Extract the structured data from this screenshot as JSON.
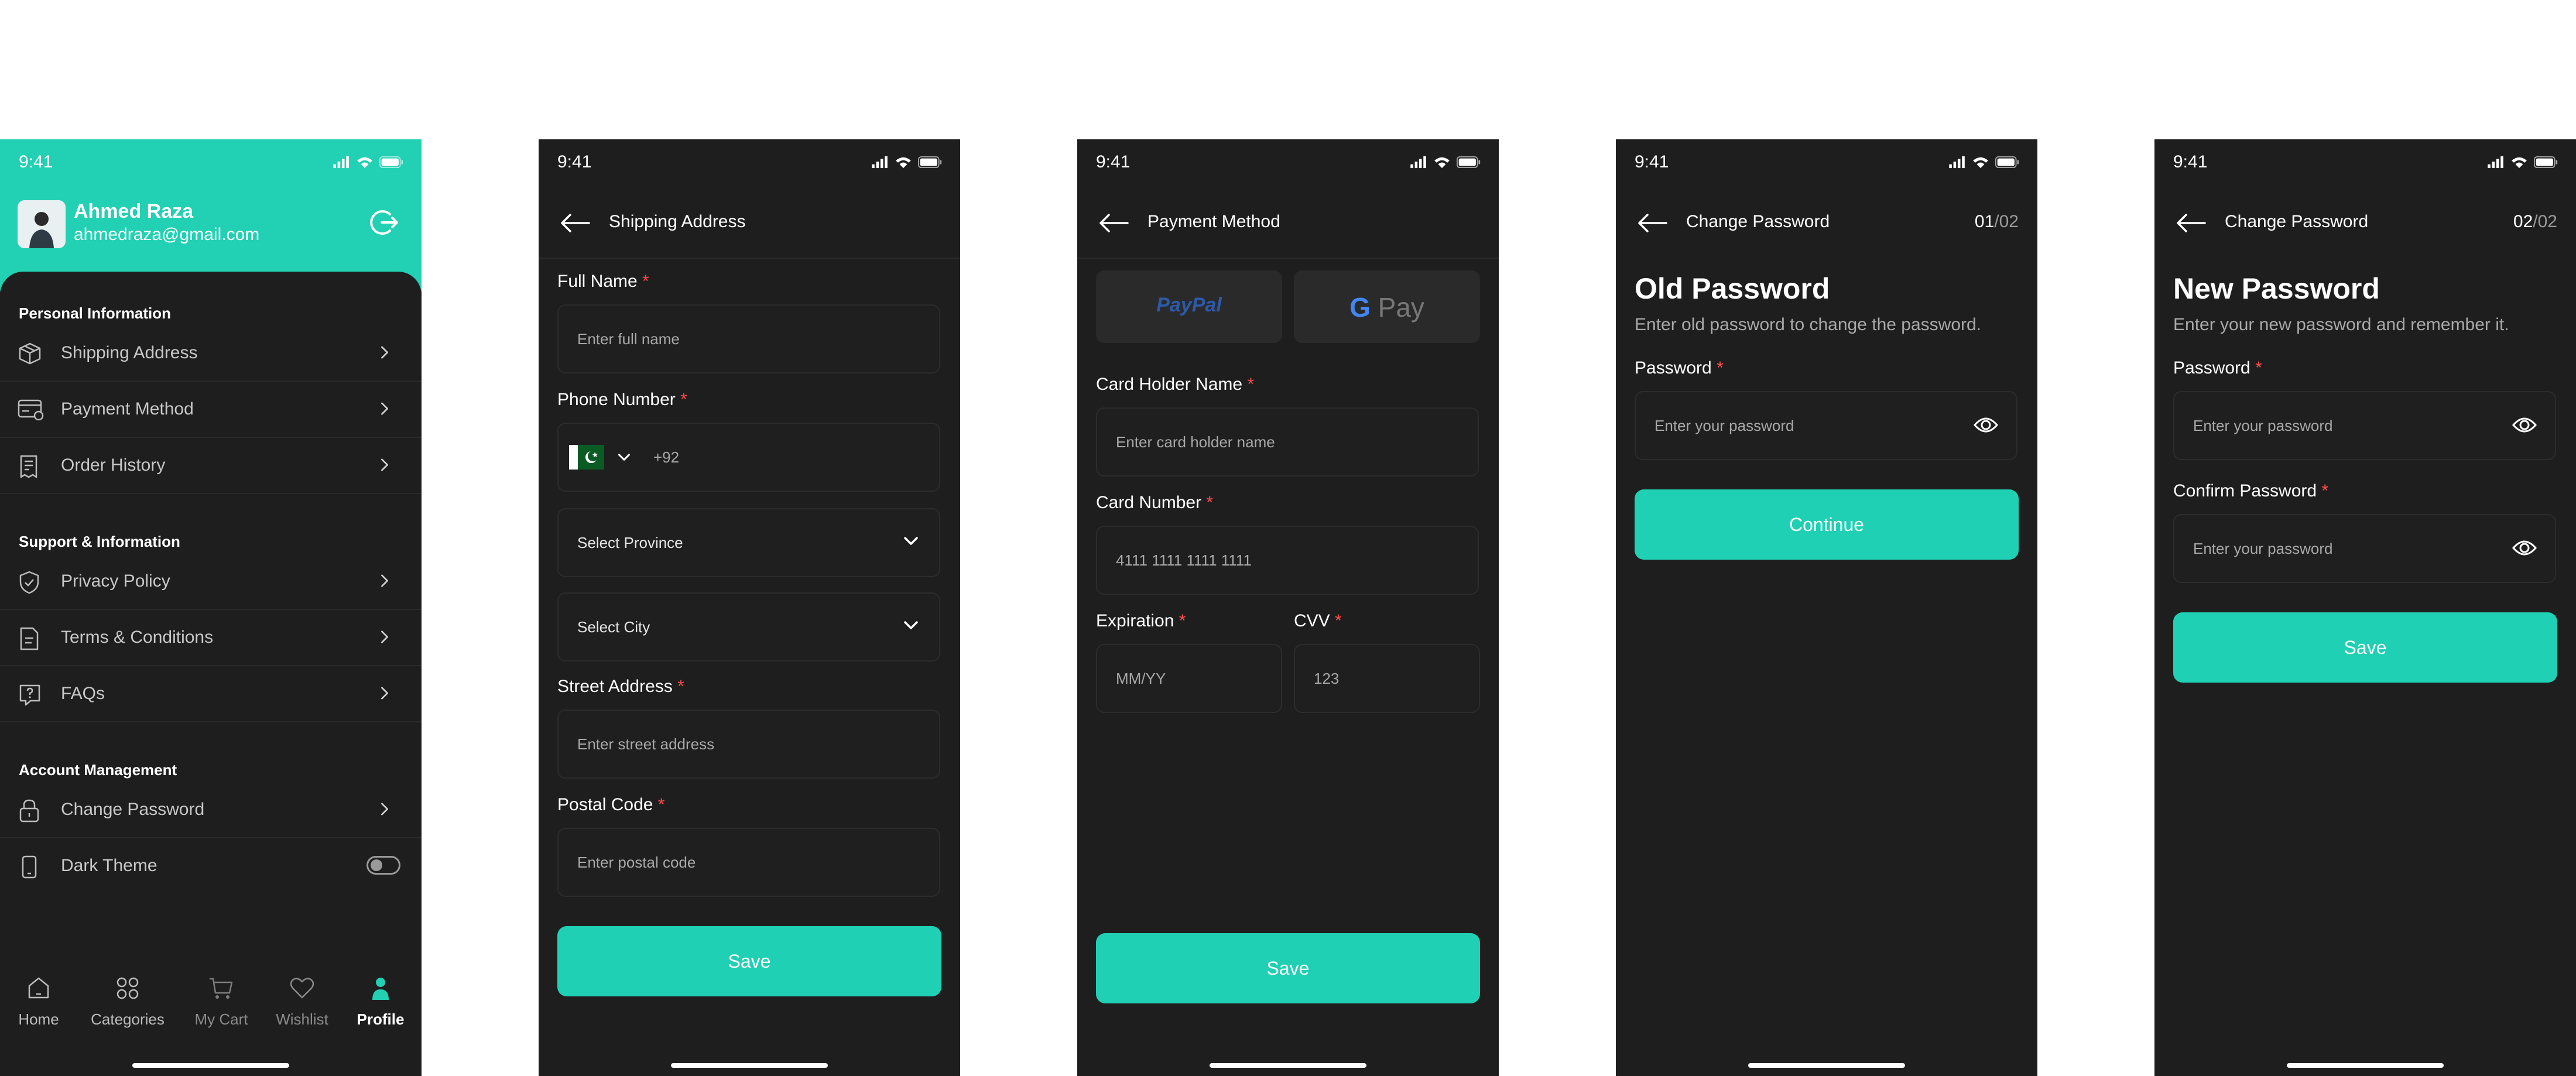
{
  "status_time": "9:41",
  "profile": {
    "name": "Ahmed Raza",
    "email": "ahmedraza@gmail.com",
    "sections": [
      {
        "title": "Personal Information",
        "items": [
          {
            "label": "Shipping Address",
            "icon": "box-icon"
          },
          {
            "label": "Payment Method",
            "icon": "card-icon"
          },
          {
            "label": "Order History",
            "icon": "receipt-icon"
          }
        ]
      },
      {
        "title": "Support & Information",
        "items": [
          {
            "label": "Privacy Policy",
            "icon": "shield-icon"
          },
          {
            "label": "Terms & Conditions",
            "icon": "document-icon"
          },
          {
            "label": "FAQs",
            "icon": "help-icon"
          }
        ]
      },
      {
        "title": "Account Management",
        "items": [
          {
            "label": "Change Password",
            "icon": "lock-icon"
          },
          {
            "label": "Dark Theme",
            "icon": "phone-icon"
          }
        ]
      }
    ],
    "dark_theme_on": false,
    "tabs": [
      {
        "label": "Home",
        "icon": "home-icon"
      },
      {
        "label": "Categories",
        "icon": "grid-icon"
      },
      {
        "label": "My Cart",
        "icon": "cart-icon"
      },
      {
        "label": "Wishlist",
        "icon": "heart-icon"
      },
      {
        "label": "Profile",
        "icon": "user-icon",
        "active": true
      }
    ]
  },
  "shipping": {
    "title": "Shipping Address",
    "full_name_label": "Full Name",
    "full_name_placeholder": "Enter full name",
    "phone_label": "Phone Number",
    "phone_code": "+92",
    "province_placeholder": "Select Province",
    "city_placeholder": "Select City",
    "street_label": "Street Address",
    "street_placeholder": "Enter street address",
    "postal_label": "Postal Code",
    "postal_placeholder": "Enter postal code",
    "save": "Save",
    "required_mark": "*"
  },
  "payment": {
    "title": "Payment Method",
    "paypal": "PayPal",
    "gpay_g": "G",
    "gpay_text": "Pay",
    "holder_label": "Card Holder Name",
    "holder_placeholder": "Enter card holder name",
    "number_label": "Card Number",
    "number_placeholder": "4111 1111 1111 1111",
    "expiration_label": "Expiration",
    "expiration_placeholder": "MM/YY",
    "cvv_label": "CVV",
    "cvv_placeholder": "123",
    "save": "Save"
  },
  "change_pw_1": {
    "title": "Change Password",
    "step_current": "01",
    "step_total": "/02",
    "heading": "Old Password",
    "subtitle": "Enter old password to change the password.",
    "password_label": "Password",
    "password_placeholder": "Enter your password",
    "continue": "Continue"
  },
  "change_pw_2": {
    "title": "Change Password",
    "step_current": "02",
    "step_total": "/02",
    "heading": "New Password",
    "subtitle": "Enter your new password and remember it.",
    "password_label": "Password",
    "password_placeholder": "Enter your password",
    "confirm_label": "Confirm Password",
    "confirm_placeholder": "Enter your password",
    "save": "Save"
  },
  "colors": {
    "accent": "#22d0b3",
    "background": "#1e1e1e",
    "required": "#ff4b4b"
  }
}
